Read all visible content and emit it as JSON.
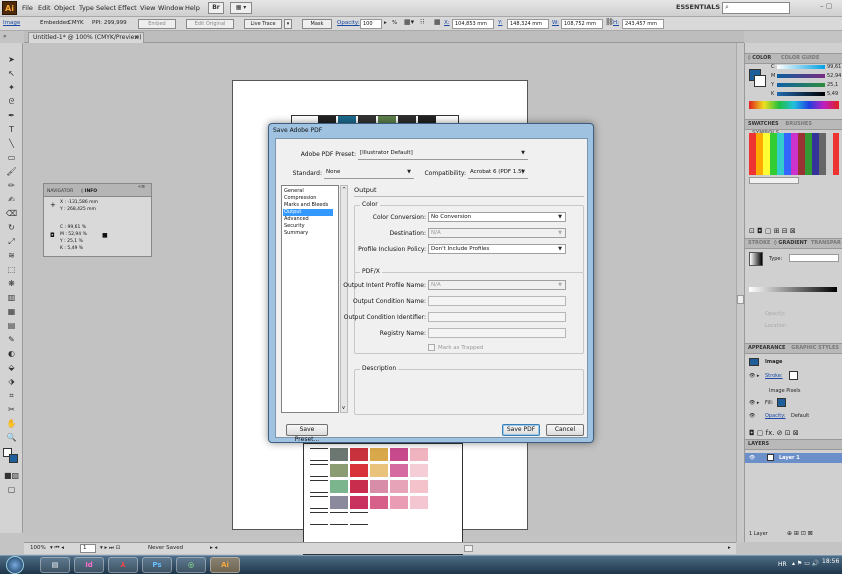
{
  "app": {
    "logo": "Ai",
    "menus": [
      "File",
      "Edit",
      "Object",
      "Type",
      "Select",
      "Effect",
      "View",
      "Window",
      "Help"
    ],
    "br_label": "Br",
    "workspace": "ESSENTIALS",
    "window_controls": "–  ▢"
  },
  "control_bar": {
    "image_label": "Image",
    "embedded": "Embedded",
    "color_mode": "CMYK",
    "ppi": "PPI: 299,999",
    "embed": "Embed",
    "edit_original": "Edit Original",
    "live_trace": "Live Trace",
    "mask": "Mask",
    "opacity_label": "Opacity:",
    "opacity_value": "100",
    "opacity_unit": "%",
    "x_label": "X:",
    "x_value": "104,853 mm",
    "y_label": "Y:",
    "y_value": "148,324 mm",
    "w_label": "W:",
    "w_value": "108,752 mm",
    "h_label": "H:",
    "h_value": "243,457 mm"
  },
  "document": {
    "tab_title": "Untitled-1* @ 100% (CMYK/Preview)",
    "tab_close": "×"
  },
  "status": {
    "zoom": "100%",
    "page": "1",
    "save_state": "Never Saved"
  },
  "navigator": {
    "tabs": [
      "NAVIGATOR",
      "◊ INFO"
    ],
    "x": "X : -131,586 mm",
    "y": "Y : 268,425 mm",
    "c": "C : 99,61 %",
    "m": "M : 52,94 %",
    "yy": "Y : 25,1 %",
    "k": "K : 5,49 %"
  },
  "right_panels": {
    "color_tabs": [
      "◊ COLOR",
      "COLOR GUIDE"
    ],
    "color_values": [
      {
        "label": "C",
        "value": "99,61"
      },
      {
        "label": "M",
        "value": "52,94"
      },
      {
        "label": "Y",
        "value": "25,1"
      },
      {
        "label": "K",
        "value": "5,49"
      }
    ],
    "swatch_tabs": [
      "SWATCHES",
      "BRUSHES",
      "SYMBOLS"
    ],
    "stroke_tabs": [
      "STROKE",
      "◊ GRADIENT",
      "TRANSPAR"
    ],
    "type_label": "Type:",
    "opacity_label": "Opacity:",
    "location_label": "Location:",
    "appearance_tabs": [
      "APPEARANCE",
      "GRAPHIC STYLES"
    ],
    "appearance_image": "Image",
    "stroke_label": "Stroke:",
    "image_pixels": "Image Pixels",
    "fill_label": "Fill:",
    "opacity_row": "Opacity:",
    "opacity_row_value": "Default",
    "layers_tab": "LAYERS",
    "layer_name": "Layer 1",
    "layer_count": "1 Layer"
  },
  "dialog": {
    "title": "Save Adobe PDF",
    "preset_label": "Adobe PDF Preset:",
    "preset_value": "[Illustrator Default]",
    "standard_label": "Standard:",
    "standard_value": "None",
    "compat_label": "Compatibility:",
    "compat_value": "Acrobat 6 (PDF 1.5)",
    "categories": [
      "General",
      "Compression",
      "Marks and Bleeds",
      "Output",
      "Advanced",
      "Security",
      "Summary"
    ],
    "selected_category": "Output",
    "section_title": "Output",
    "color_group": "Color",
    "color_conversion_label": "Color Conversion:",
    "color_conversion_value": "No Conversion",
    "destination_label": "Destination:",
    "destination_value": "N/A",
    "profile_policy_label": "Profile Inclusion Policy:",
    "profile_policy_value": "Don't Include Profiles",
    "pdfx_group": "PDF/X",
    "intent_label": "Output Intent Profile Name:",
    "intent_value": "N/A",
    "condition_name_label": "Output Condition Name:",
    "condition_id_label": "Output Condition Identifier:",
    "registry_label": "Registry Name:",
    "trapped_label": "Mark as Trapped",
    "description_group": "Description",
    "save_preset": "Save Preset...",
    "save_pdf": "Save PDF",
    "cancel": "Cancel"
  },
  "taskbar": {
    "apps": [
      "",
      "",
      "Id",
      "",
      "Ps",
      "",
      "Ai"
    ],
    "tray_lang": "HR",
    "time": "18:56"
  }
}
